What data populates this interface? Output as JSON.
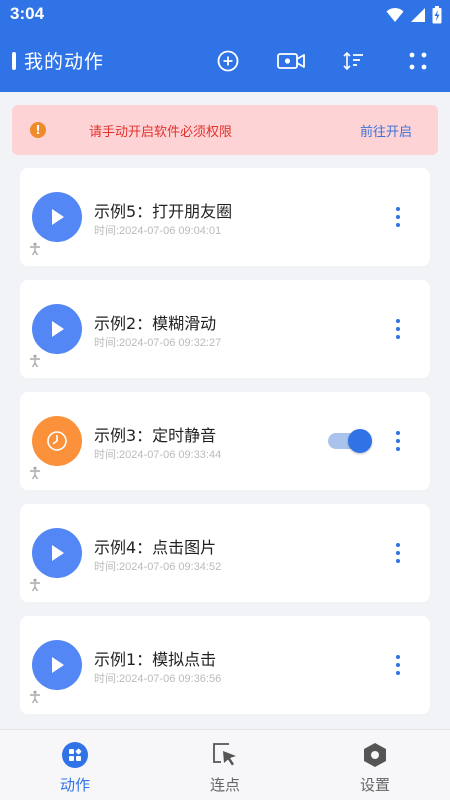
{
  "status_bar": {
    "time": "3:04"
  },
  "app_bar": {
    "title": "我的动作",
    "actions": [
      "add-circle-icon",
      "video-camera-icon",
      "sort-icon",
      "grid-dots-icon"
    ]
  },
  "banner": {
    "message": "请手动开启软件必须权限",
    "action_label": "前往开启",
    "icon": "warning-icon"
  },
  "actions": [
    {
      "name": "示例5：打开朋友圈",
      "time": "时间:2024-07-06 09:04:01",
      "icon": "play-icon",
      "color": "#5387f5",
      "toggle": null
    },
    {
      "name": "示例2：模糊滑动",
      "time": "时间:2024-07-06 09:32:27",
      "icon": "play-icon",
      "color": "#5387f5",
      "toggle": null
    },
    {
      "name": "示例3：定时静音",
      "time": "时间:2024-07-06 09:33:44",
      "icon": "clock-icon",
      "color": "#fb923b",
      "toggle": true
    },
    {
      "name": "示例4：点击图片",
      "time": "时间:2024-07-06 09:34:52",
      "icon": "play-icon",
      "color": "#5387f5",
      "toggle": null
    },
    {
      "name": "示例1：模拟点击",
      "time": "时间:2024-07-06 09:36:56",
      "icon": "play-icon",
      "color": "#5387f5",
      "toggle": null
    }
  ],
  "tabs": [
    {
      "label": "动作",
      "icon": "actions-grid-icon",
      "active": true
    },
    {
      "label": "连点",
      "icon": "cursor-click-icon",
      "active": false
    },
    {
      "label": "设置",
      "icon": "settings-hex-icon",
      "active": false
    }
  ],
  "colors": {
    "primary": "#2f73e6",
    "banner_bg": "#fdd3d6",
    "banner_text": "#e4312b",
    "play_blue": "#5387f5",
    "timer_orange": "#fb923b"
  }
}
